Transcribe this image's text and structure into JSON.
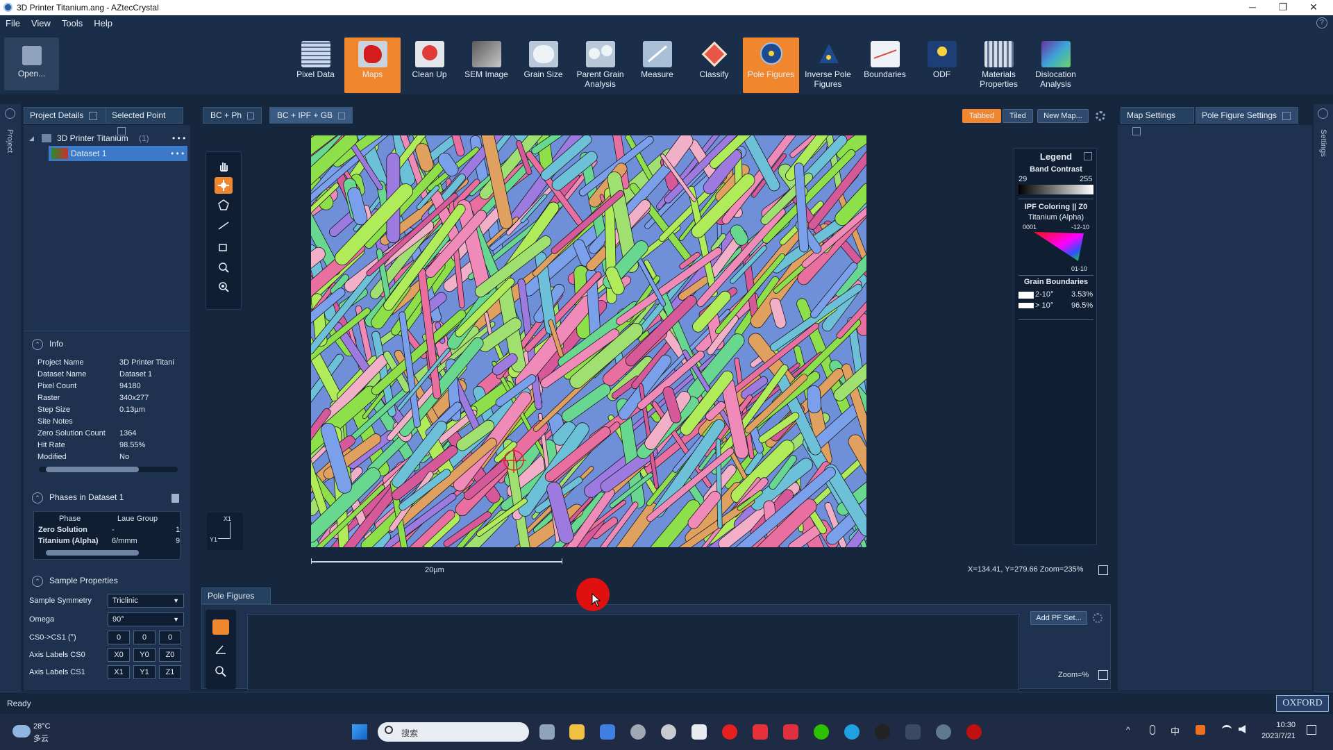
{
  "window": {
    "title": "3D Printer Titanium.ang - AZtecCrystal",
    "minimize": "─",
    "maximize": "❐",
    "close": "✕"
  },
  "menu": [
    "File",
    "View",
    "Tools",
    "Help"
  ],
  "toolbar": {
    "open_label": "Open...",
    "buttons": [
      "Pixel Data",
      "Maps",
      "Clean Up",
      "SEM Image",
      "Grain Size",
      "Parent Grain Analysis",
      "Measure",
      "Classify",
      "Pole Figures",
      "Inverse Pole Figures",
      "Boundaries",
      "ODF",
      "Materials Properties",
      "Dislocation Analysis"
    ],
    "active": [
      "Maps",
      "Pole Figures"
    ]
  },
  "side_labels": {
    "left": "Project",
    "right": "Settings"
  },
  "left_tabs": [
    "Project Details",
    "Selected Point"
  ],
  "tree": {
    "project": "3D Printer Titanium",
    "project_count": "(1)",
    "dataset": "Dataset 1",
    "more": "• • •"
  },
  "info": {
    "heading": "Info",
    "rows": [
      {
        "k": "Project Name",
        "v": "3D Printer Titani"
      },
      {
        "k": "Dataset Name",
        "v": "Dataset 1"
      },
      {
        "k": "Pixel Count",
        "v": "94180"
      },
      {
        "k": "Raster",
        "v": "340x277"
      },
      {
        "k": "Step Size",
        "v": "0.13µm"
      },
      {
        "k": "Site Notes",
        "v": ""
      },
      {
        "k": "Zero Solution Count",
        "v": "1364"
      },
      {
        "k": "Hit Rate",
        "v": "98.55%"
      },
      {
        "k": "Modified",
        "v": "No"
      }
    ]
  },
  "phases": {
    "heading": "Phases in Dataset 1",
    "cols": [
      "Phase",
      "Laue Group"
    ],
    "rows": [
      {
        "phase": "Zero Solution",
        "laue": "-",
        "n": "1"
      },
      {
        "phase": "Titanium (Alpha)",
        "laue": "6/mmm",
        "n": "9"
      }
    ]
  },
  "sample": {
    "heading": "Sample Properties",
    "symmetry_label": "Sample Symmetry",
    "symmetry_value": "Triclinic",
    "omega_label": "Omega",
    "omega_value": "90°",
    "cs_label": "CS0->CS1 (°)",
    "cs_values": [
      "0",
      "0",
      "0"
    ],
    "cs0_label": "Axis Labels CS0",
    "cs0_values": [
      "X0",
      "Y0",
      "Z0"
    ],
    "cs1_label": "Axis Labels CS1",
    "cs1_values": [
      "X1",
      "Y1",
      "Z1"
    ]
  },
  "map_tabs": [
    "BC + Ph",
    "BC + IPF + GB"
  ],
  "view_buttons": {
    "tabbed": "Tabbed",
    "tiled": "Tiled",
    "new_map": "New Map..."
  },
  "right_tabs": [
    "Map Settings",
    "Pole Figure Settings"
  ],
  "legend": {
    "title": "Legend",
    "band_contrast": "Band Contrast",
    "bc_min": "29",
    "bc_max": "255",
    "ipf_title": "IPF Coloring || Z0",
    "ipf_phase": "Titanium (Alpha)",
    "ipf_0001": "0001",
    "ipf_1210": "-12-10",
    "ipf_0110": "01-10",
    "gb_title": "Grain Boundaries",
    "gb_rows": [
      {
        "label": "2-10°",
        "pct": "3.53%"
      },
      {
        "label": "> 10°",
        "pct": "96.5%"
      }
    ]
  },
  "axes_icon": {
    "x": "X1",
    "y": "Y1"
  },
  "scale_label": "20µm",
  "coords": "X=134.41, Y=279.66  Zoom=235%",
  "pole_figures": {
    "tab": "Pole Figures",
    "add_btn": "Add PF Set...",
    "zoom": "Zoom=%"
  },
  "status": "Ready",
  "brand": "OXFORD",
  "taskbar": {
    "temp": "28°C",
    "weather": "多云",
    "search": "搜索",
    "time": "10:30",
    "date": "2023/7/21",
    "ime": "中"
  },
  "colors": {
    "accent": "#f0872f",
    "bg": "#16263d",
    "panel": "#1e324f",
    "selection": "#3d79c9"
  }
}
